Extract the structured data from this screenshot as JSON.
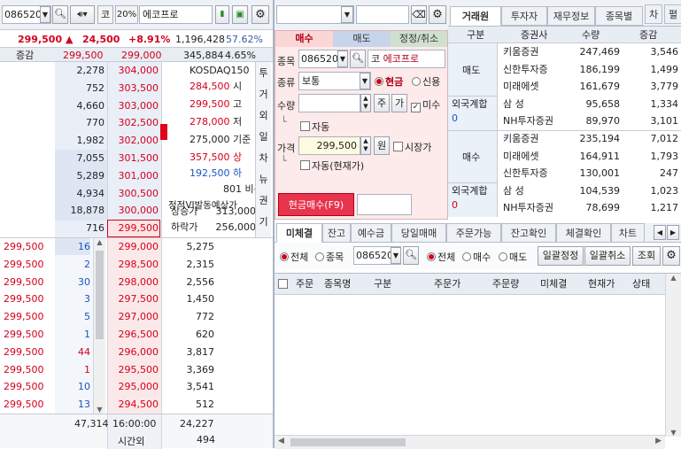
{
  "left": {
    "code": "086520",
    "mkt": "코",
    "pct": "20%",
    "name": "에코프로",
    "price": "299,500",
    "arrow": "▲",
    "change": "24,500",
    "rate": "+8.91%",
    "volume": "1,196,428",
    "volrate": "57.62%",
    "hdr_label": "증감",
    "hdr_price1": "299,500",
    "hdr_price2": "299,000",
    "hdr_vol": "345,884",
    "hdr_rate": "4.65%",
    "ask": [
      {
        "qty": "2,278",
        "price": "304,000"
      },
      {
        "qty": "752",
        "price": "303,500"
      },
      {
        "qty": "4,660",
        "price": "303,000"
      },
      {
        "qty": "770",
        "price": "302,500"
      },
      {
        "qty": "1,982",
        "price": "302,000"
      },
      {
        "qty": "7,055",
        "price": "301,500"
      },
      {
        "qty": "5,289",
        "price": "301,000"
      },
      {
        "qty": "4,934",
        "price": "300,500"
      },
      {
        "qty": "18,878",
        "price": "300,000"
      },
      {
        "qty": "716",
        "price": "299,500"
      }
    ],
    "bid": [
      {
        "price": "299,000",
        "qty": "5,275"
      },
      {
        "price": "298,500",
        "qty": "2,315"
      },
      {
        "price": "298,000",
        "qty": "2,556"
      },
      {
        "price": "297,500",
        "qty": "1,450"
      },
      {
        "price": "297,000",
        "qty": "772"
      },
      {
        "price": "296,500",
        "qty": "620"
      },
      {
        "price": "296,000",
        "qty": "3,817"
      },
      {
        "price": "295,500",
        "qty": "3,369"
      },
      {
        "price": "295,000",
        "qty": "3,541"
      },
      {
        "price": "294,500",
        "qty": "512"
      }
    ],
    "ticks": [
      {
        "price": "299,500",
        "qty": "16"
      },
      {
        "price": "299,500",
        "qty": "2"
      },
      {
        "price": "299,500",
        "qty": "30"
      },
      {
        "price": "299,500",
        "qty": "3"
      },
      {
        "price": "299,500",
        "qty": "5"
      },
      {
        "price": "299,500",
        "qty": "1"
      },
      {
        "price": "299,500",
        "qty": "44"
      },
      {
        "price": "299,500",
        "qty": "1"
      },
      {
        "price": "299,500",
        "qty": "10"
      },
      {
        "price": "299,500",
        "qty": "13"
      }
    ],
    "info": {
      "idx": "KOSDAQ150",
      "r1v": "284,500",
      "r1l": "시",
      "r2v": "299,500",
      "r2l": "고",
      "r3v": "278,000",
      "r3l": "저",
      "r4v": "275,000",
      "r4l": "기준",
      "r5v": "357,500",
      "r5l": "상",
      "r6v": "192,500",
      "r6l": "하",
      "r7v": "801",
      "r7l": "비용",
      "vi": "정적VI발동예상가",
      "up_l": "상승가",
      "up_v": "313,000",
      "dn_l": "하락가",
      "dn_v": "256,000"
    },
    "side_tabs": [
      "투",
      "거",
      "외",
      "일",
      "차",
      "뉴",
      "권",
      "기"
    ],
    "foot_ask": "47,314",
    "foot_time": "16:00:00",
    "foot_bid": "24,227",
    "foot_after_l": "시간외",
    "foot_after_v": "494"
  },
  "order": {
    "tabs": [
      "매수",
      "매도",
      "정정/취소"
    ],
    "code_l": "종목",
    "code": "086520",
    "mkt": "코",
    "name": "에코프로",
    "type_l": "종류",
    "type": "보통",
    "cash": "현금",
    "credit": "신용",
    "qty_l": "수량",
    "ju": "주",
    "ga": "가",
    "misu": "미수",
    "auto": "자동",
    "price_l": "가격",
    "price": "299,500",
    "won": "원",
    "market": "시장가",
    "auto2": "자동(현재가)",
    "submit": "현금매수(F9)"
  },
  "broker": {
    "tabs": [
      "거래원",
      "투자자",
      "재무정보",
      "종목별",
      "차",
      "펼"
    ],
    "headers": [
      "구분",
      "증권사",
      "수량",
      "증감"
    ],
    "sell_label": "매도",
    "buy_label": "매수",
    "foreign": "외국계합",
    "foreign_v": "0",
    "sell": [
      {
        "name": "키움증권",
        "qty": "247,469",
        "chg": "3,546"
      },
      {
        "name": "신한투자증",
        "qty": "186,199",
        "chg": "1,499"
      },
      {
        "name": "미래에셋",
        "qty": "161,679",
        "chg": "3,779"
      },
      {
        "name": "삼 성",
        "qty": "95,658",
        "chg": "1,334"
      },
      {
        "name": "NH투자증권",
        "qty": "89,970",
        "chg": "3,101"
      }
    ],
    "buy": [
      {
        "name": "키움증권",
        "qty": "235,194",
        "chg": "7,012"
      },
      {
        "name": "미래에셋",
        "qty": "164,911",
        "chg": "1,793"
      },
      {
        "name": "신한투자증",
        "qty": "130,001",
        "chg": "247"
      },
      {
        "name": "삼 성",
        "qty": "104,539",
        "chg": "1,023"
      },
      {
        "name": "NH투자증권",
        "qty": "78,699",
        "chg": "1,217"
      }
    ]
  },
  "pending": {
    "tabs": [
      "미체결",
      "잔고",
      "예수금",
      "당일매매",
      "주문가능",
      "잔고확인",
      "체결확인",
      "차트"
    ],
    "all": "전체",
    "stock": "종목",
    "code": "086520",
    "all2": "전체",
    "buy": "매수",
    "sell": "매도",
    "btn1": "일괄정정",
    "btn2": "일괄취소",
    "btn3": "조회",
    "cols": [
      "주문",
      "종목명",
      "구분",
      "주문가",
      "주문량",
      "미체결",
      "현재가",
      "상태"
    ]
  }
}
